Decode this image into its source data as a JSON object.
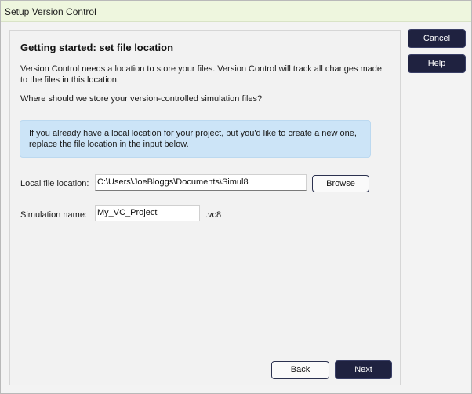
{
  "window": {
    "title": "Setup Version Control"
  },
  "content": {
    "heading": "Getting started: set file location",
    "description": "Version Control needs a location to store your files. Version Control will track all changes made to the files in this location.",
    "question": "Where should we store your version-controlled simulation files?",
    "info": "If you already have a local location for your project, but you'd like to create a new one, replace the file location in the input below."
  },
  "form": {
    "location_label": "Local file location:",
    "location_value": "C:\\Users\\JoeBloggs\\Documents\\Simul8",
    "browse_label": "Browse",
    "name_label": "Simulation name:",
    "name_value": "My_VC_Project",
    "extension": ".vc8"
  },
  "side_buttons": {
    "cancel": "Cancel",
    "help": "Help"
  },
  "footer": {
    "back": "Back",
    "next": "Next"
  },
  "colors": {
    "titlebar": "#eef6de",
    "info_background": "#cce4f7",
    "primary_button": "#1f2240"
  }
}
